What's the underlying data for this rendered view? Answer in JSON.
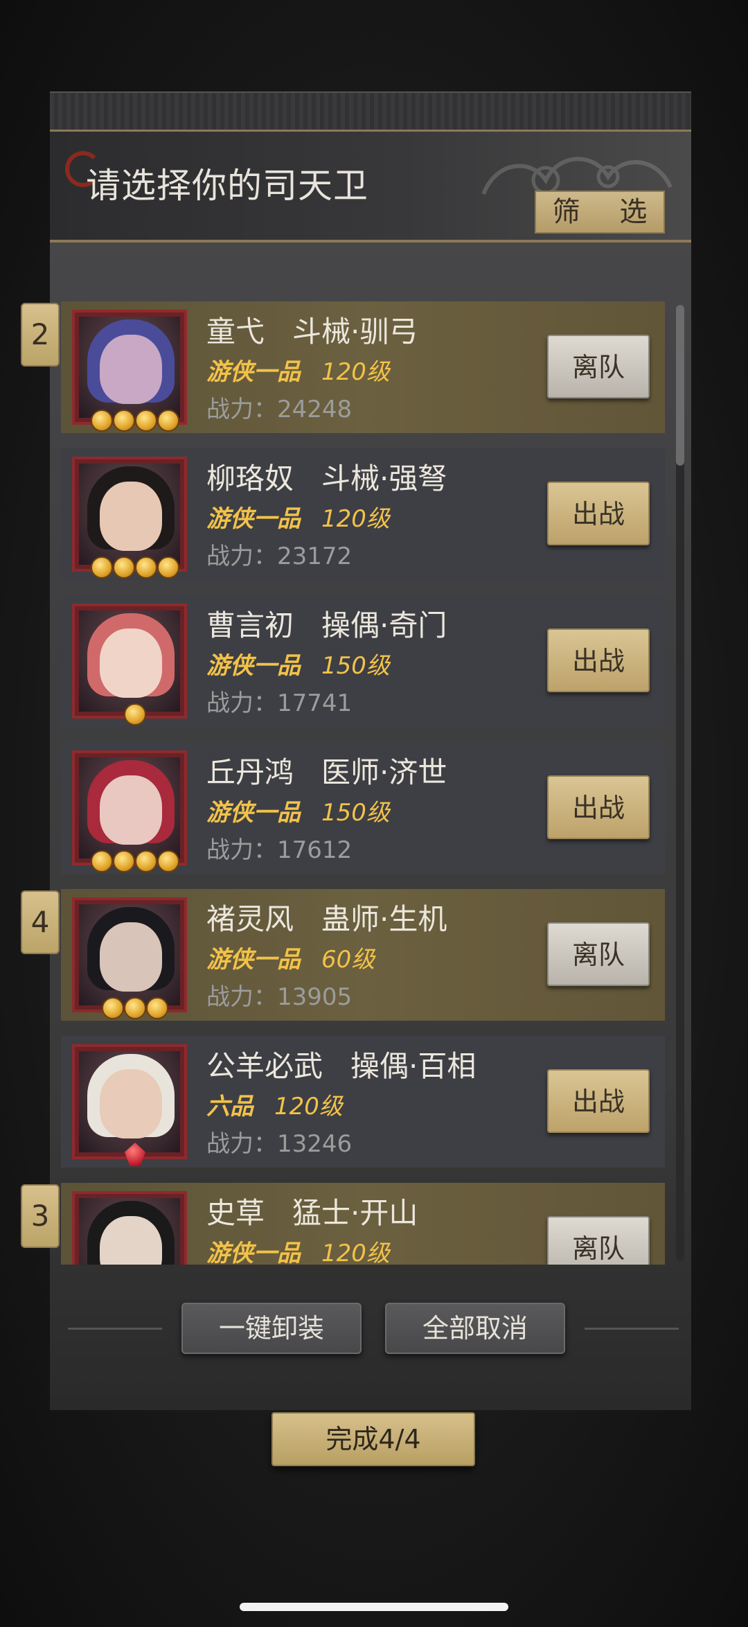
{
  "header": {
    "title": "请选择你的司天卫",
    "filter_label": "筛 选"
  },
  "characters": [
    {
      "slot": "2",
      "name": "童弋",
      "class": "斗械·驯弓",
      "rank": "游侠一品",
      "level": "120级",
      "power_label": "战力：24248",
      "stars": 4,
      "star_type": "gold",
      "action": "离队",
      "selected": true,
      "colors": {
        "hair": "#4a4c9a",
        "face": "#c8a8c4"
      }
    },
    {
      "slot": "",
      "name": "柳珞奴",
      "class": "斗械·强弩",
      "rank": "游侠一品",
      "level": "120级",
      "power_label": "战力：23172",
      "stars": 4,
      "star_type": "gold",
      "action": "出战",
      "selected": false,
      "colors": {
        "hair": "#1e1a1a",
        "face": "#e6c8b4"
      }
    },
    {
      "slot": "",
      "name": "曹言初",
      "class": "操偶·奇门",
      "rank": "游侠一品",
      "level": "150级",
      "power_label": "战力：17741",
      "stars": 1,
      "star_type": "gold",
      "action": "出战",
      "selected": false,
      "colors": {
        "hair": "#d06a6a",
        "face": "#f0d4c8"
      }
    },
    {
      "slot": "",
      "name": "丘丹鸿",
      "class": "医师·济世",
      "rank": "游侠一品",
      "level": "150级",
      "power_label": "战力：17612",
      "stars": 4,
      "star_type": "gold",
      "action": "出战",
      "selected": false,
      "colors": {
        "hair": "#a82a3c",
        "face": "#e8c8c0"
      }
    },
    {
      "slot": "4",
      "name": "褚灵风",
      "class": "蛊师·生机",
      "rank": "游侠一品",
      "level": "60级",
      "power_label": "战力：13905",
      "stars": 3,
      "star_type": "gold",
      "action": "离队",
      "selected": true,
      "colors": {
        "hair": "#1a1a1e",
        "face": "#d8c4b8"
      }
    },
    {
      "slot": "",
      "name": "公羊必武",
      "class": "操偶·百相",
      "rank": "六品",
      "level": "120级",
      "power_label": "战力：13246",
      "stars": 1,
      "star_type": "red",
      "action": "出战",
      "selected": false,
      "colors": {
        "hair": "#e8e4dc",
        "face": "#e8cbb8"
      }
    },
    {
      "slot": "3",
      "name": "史草",
      "class": "猛士·开山",
      "rank": "游侠一品",
      "level": "120级",
      "power_label": "",
      "stars": 0,
      "star_type": "gold",
      "action": "离队",
      "selected": true,
      "colors": {
        "hair": "#1a1a1a",
        "face": "#e4d4c8"
      }
    }
  ],
  "bottom": {
    "unequip_label": "一键卸装",
    "cancel_all_label": "全部取消",
    "done_label": "完成4/4"
  }
}
